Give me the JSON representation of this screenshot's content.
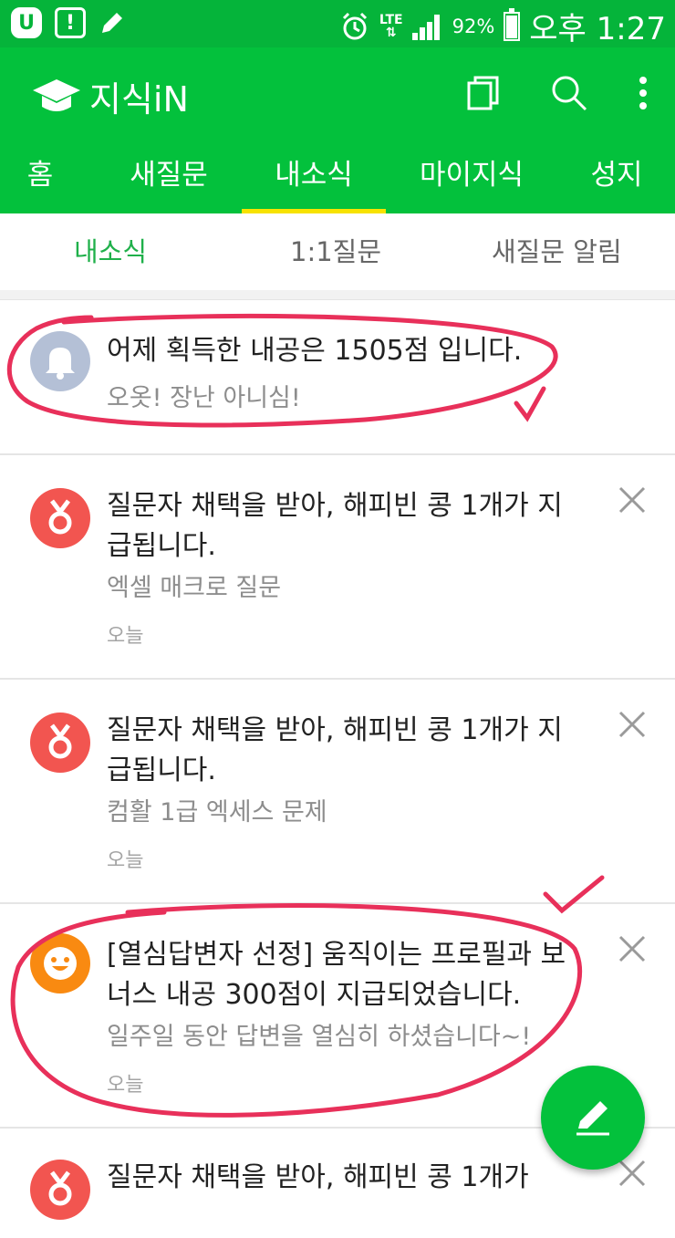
{
  "status_bar": {
    "network": "LTE",
    "battery": "92%",
    "time": "오후 1:27"
  },
  "app_bar": {
    "title": "지식iN",
    "icons": [
      "graduation-cap-icon",
      "copy-icon",
      "search-icon",
      "more-vert-icon"
    ]
  },
  "tabs": [
    {
      "label": "홈"
    },
    {
      "label": "새질문"
    },
    {
      "label": "내소식",
      "active": true
    },
    {
      "label": "마이지식"
    },
    {
      "label": "성지"
    }
  ],
  "subtabs": [
    {
      "label": "내소식",
      "active": true
    },
    {
      "label": "1:1질문"
    },
    {
      "label": "새질문 알림"
    }
  ],
  "notifications": [
    {
      "icon": "bell-icon",
      "icon_color": "#b4c0d6",
      "title": "어제 획득한 내공은 1505점 입니다.",
      "subtitle": "오옷! 장난 아니심!",
      "date": "",
      "closable": false
    },
    {
      "icon": "medal-icon",
      "icon_color": "#f25550",
      "title": "질문자 채택을 받아, 해피빈 콩 1개가 지급됩니다.",
      "subtitle": "엑셀 매크로 질문",
      "date": "오늘",
      "closable": true
    },
    {
      "icon": "medal-icon",
      "icon_color": "#f25550",
      "title": "질문자 채택을 받아, 해피빈 콩 1개가 지급됩니다.",
      "subtitle": "컴활 1급 엑세스 문제",
      "date": "오늘",
      "closable": true
    },
    {
      "icon": "smile-icon",
      "icon_color": "#f98a11",
      "title": "[열심답변자 선정] 움직이는 프로필과 보너스 내공 300점이 지급되었습니다.",
      "subtitle": "일주일 동안 답변을 열심히 하셨습니다~!",
      "date": "오늘",
      "closable": true
    },
    {
      "icon": "medal-icon",
      "icon_color": "#f25550",
      "title": "질문자 채택을 받아, 해피빈 콩 1개가",
      "subtitle": "",
      "date": "",
      "closable": true
    }
  ],
  "fab": {
    "icon": "pencil-icon"
  },
  "colors": {
    "brand_green": "#03c13c",
    "tab_indicator": "#f7e200",
    "annotation_red": "#e8305a"
  }
}
